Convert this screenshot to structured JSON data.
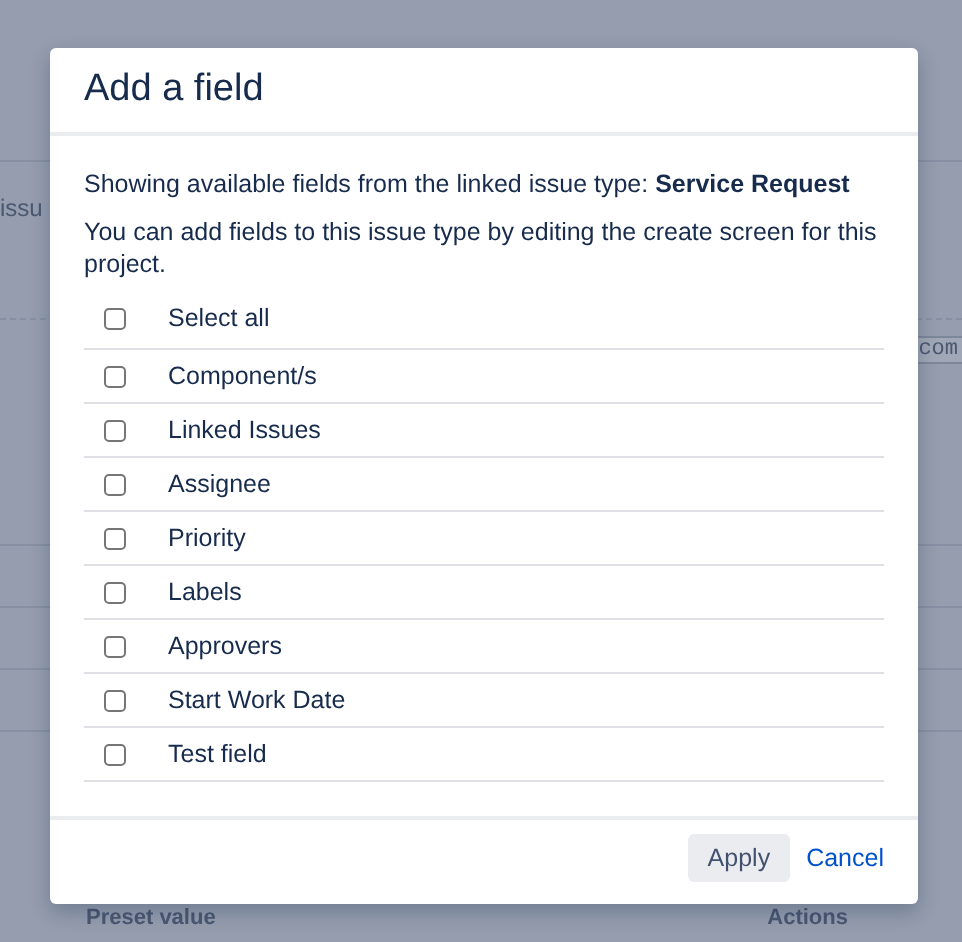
{
  "background": {
    "fragment_left": "issu",
    "fragment_right": "com",
    "columns": [
      "Preset value",
      "Actions"
    ]
  },
  "dialog": {
    "title": "Add a field",
    "intro": "Showing available fields from the linked issue type: **Service Request**",
    "hint": "You can add fields to this issue type by editing the create screen for this project.",
    "select_all": {
      "label": "Select all",
      "checked": false
    },
    "fields": [
      {
        "label": "Component/s",
        "checked": false
      },
      {
        "label": "Linked Issues",
        "checked": false
      },
      {
        "label": "Assignee",
        "checked": false
      },
      {
        "label": "Priority",
        "checked": false
      },
      {
        "label": "Labels",
        "checked": false
      },
      {
        "label": "Approvers",
        "checked": false
      },
      {
        "label": "Start Work Date",
        "checked": false
      },
      {
        "label": "Test field",
        "checked": false
      }
    ],
    "buttons": {
      "apply": "Apply",
      "cancel": "Cancel"
    }
  }
}
